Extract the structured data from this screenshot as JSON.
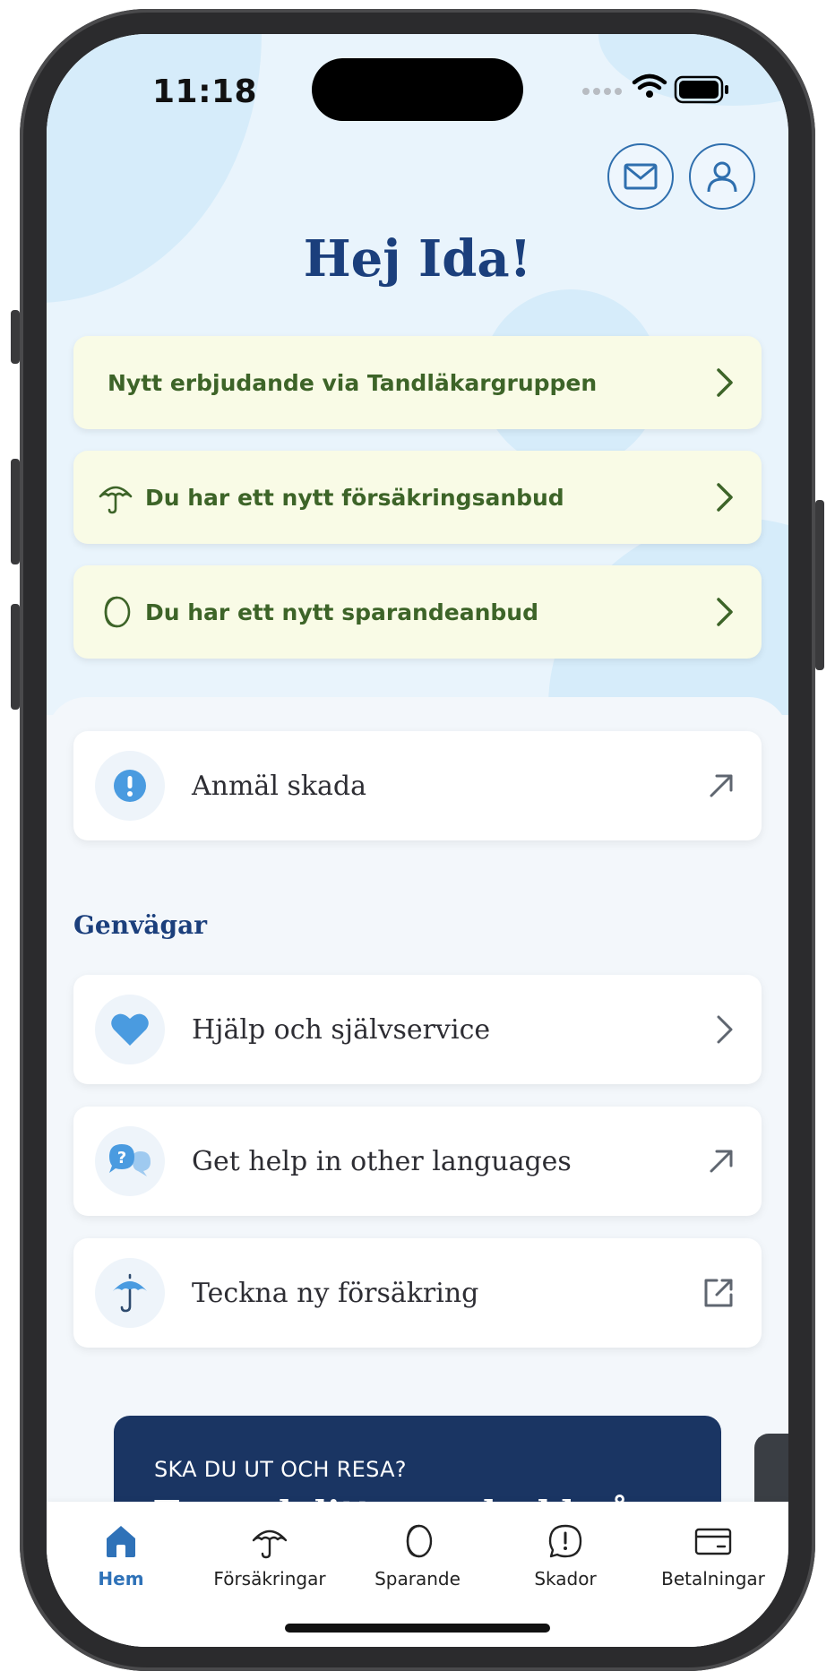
{
  "status": {
    "time": "11:18"
  },
  "header": {
    "greeting": "Hej Ida!"
  },
  "notices": [
    {
      "label": "Nytt erbjudande via Tandläkargruppen",
      "icon": ""
    },
    {
      "label": "Du har ett nytt försäkringsanbud",
      "icon": "umbrella-icon"
    },
    {
      "label": "Du har ett nytt sparandeanbud",
      "icon": "coin-icon"
    }
  ],
  "report": {
    "label": "Anmäl skada",
    "icon": "exclamation-icon",
    "action_icon": "arrow-up-right-icon"
  },
  "shortcuts": {
    "title": "Genvägar",
    "items": [
      {
        "label": "Hjälp och självservice",
        "icon": "heart-icon",
        "action_icon": "chevron-right-icon"
      },
      {
        "label": "Get help in other languages",
        "icon": "chat-bubbles-icon",
        "action_icon": "arrow-up-right-icon"
      },
      {
        "label": "Teckna ny försäkring",
        "icon": "umbrella-icon",
        "action_icon": "external-link-icon"
      }
    ]
  },
  "promo": {
    "eyebrow": "SKA DU UT OCH RESA?",
    "headline": "Ta med ditt reseskydd på"
  },
  "tabs": [
    {
      "label": "Hem",
      "icon": "home-icon",
      "active": true
    },
    {
      "label": "Försäkringar",
      "icon": "umbrella-icon",
      "active": false
    },
    {
      "label": "Sparande",
      "icon": "coin-icon",
      "active": false
    },
    {
      "label": "Skador",
      "icon": "exclamation-circle-icon",
      "active": false
    },
    {
      "label": "Betalningar",
      "icon": "card-icon",
      "active": false
    }
  ],
  "colors": {
    "brand_blue": "#1b3f7c",
    "accent_blue": "#2f72b8",
    "notice_bg": "#f9fbe6",
    "notice_text": "#3d6428",
    "promo_bg": "#1a3563"
  }
}
